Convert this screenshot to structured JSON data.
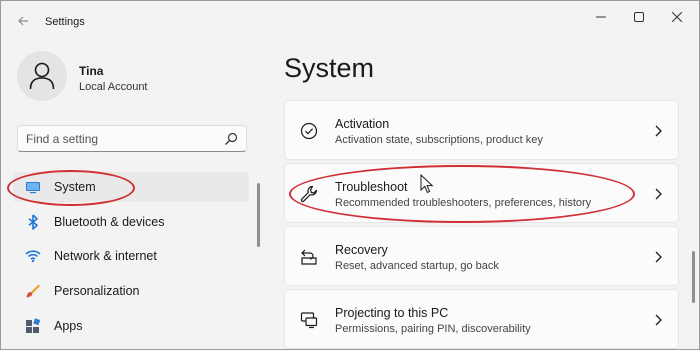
{
  "window": {
    "title": "Settings",
    "back_icon": "back-arrow-icon",
    "controls": [
      "minimize-icon",
      "maximize-icon",
      "close-icon"
    ]
  },
  "profile": {
    "name": "Tina",
    "account_type": "Local Account"
  },
  "search": {
    "placeholder": "Find a setting",
    "value": ""
  },
  "sidebar": {
    "items": [
      {
        "label": "System",
        "icon": "system-display-icon",
        "selected": true
      },
      {
        "label": "Bluetooth & devices",
        "icon": "bluetooth-icon"
      },
      {
        "label": "Network & internet",
        "icon": "wifi-icon"
      },
      {
        "label": "Personalization",
        "icon": "brush-icon"
      },
      {
        "label": "Apps",
        "icon": "apps-icon"
      }
    ]
  },
  "main": {
    "title": "System",
    "cards": [
      {
        "title": "Activation",
        "description": "Activation state, subscriptions, product key",
        "icon": "check-circle-icon"
      },
      {
        "title": "Troubleshoot",
        "description": "Recommended troubleshooters, preferences, history",
        "icon": "wrench-icon"
      },
      {
        "title": "Recovery",
        "description": "Reset, advanced startup, go back",
        "icon": "recovery-icon"
      },
      {
        "title": "Projecting to this PC",
        "description": "Permissions, pairing PIN, discoverability",
        "icon": "projecting-icon"
      }
    ]
  },
  "colors": {
    "accent": "#0067c0",
    "annotation": "#d12f36"
  }
}
